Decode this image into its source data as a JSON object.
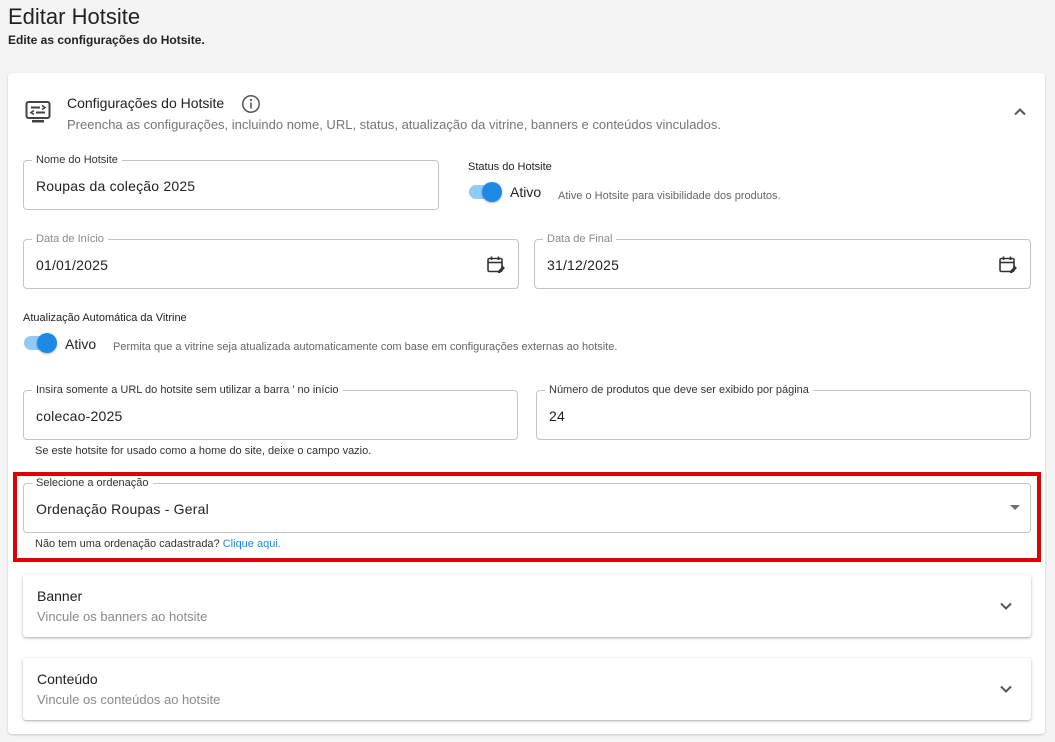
{
  "header": {
    "title": "Editar Hotsite",
    "subtitle": "Edite as configurações do Hotsite."
  },
  "config_section": {
    "icon": "settings-display-icon",
    "title": "Configurações do Hotsite",
    "description": "Preencha as configurações, incluindo nome, URL, status, atualização da vitrine, banners e conteúdos vinculados."
  },
  "form": {
    "name": {
      "label": "Nome do Hotsite",
      "value": "Roupas da coleção 2025"
    },
    "status": {
      "label": "Status do Hotsite",
      "state": "Ativo",
      "hint": "Ative o Hotsite para visibilidade dos produtos.",
      "enabled": true
    },
    "start_date": {
      "label": "Data de Início",
      "value": "01/01/2025"
    },
    "end_date": {
      "label": "Data de Final",
      "value": "31/12/2025"
    },
    "auto_update": {
      "label": "Atualização Automática da Vitrine",
      "state": "Ativo",
      "hint": "Permita que a vitrine seja atualizada automaticamente com base em configurações externas ao hotsite.",
      "enabled": true
    },
    "url": {
      "label": "Insira somente a URL do hotsite sem utilizar a barra ' no início",
      "value": "colecao-2025",
      "helper": "Se este hotsite for usado como a home do site, deixe o campo vazio."
    },
    "per_page": {
      "label": "Número de produtos que deve ser exibido por página",
      "value": "24"
    },
    "ordering": {
      "label": "Selecione a ordenação",
      "value": "Ordenação Roupas - Geral",
      "helper_text": "Não tem uma ordenação cadastrada?",
      "helper_link": "Clique aqui."
    }
  },
  "panels": [
    {
      "title": "Banner",
      "description": "Vincule os banners ao hotsite"
    },
    {
      "title": "Conteúdo",
      "description": "Vincule os conteúdos ao hotsite"
    }
  ],
  "colors": {
    "accent": "#1e88e5",
    "switch_track": "#90caf9",
    "highlight": "#e00000"
  }
}
